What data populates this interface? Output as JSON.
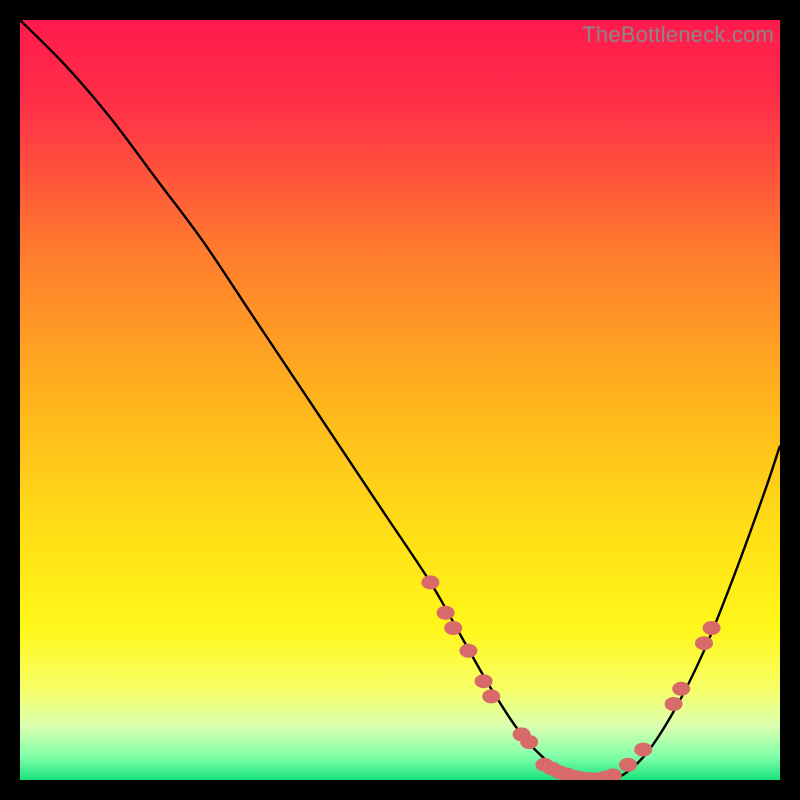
{
  "watermark": "TheBottleneck.com",
  "chart_data": {
    "type": "line",
    "title": "",
    "xlabel": "",
    "ylabel": "",
    "xlim": [
      0,
      100
    ],
    "ylim": [
      0,
      100
    ],
    "curve": {
      "name": "bottleneck-curve",
      "x": [
        0,
        6,
        12,
        18,
        24,
        30,
        36,
        42,
        48,
        54,
        58,
        62,
        66,
        70,
        74,
        78,
        82,
        86,
        90,
        94,
        98,
        100
      ],
      "y": [
        100,
        94,
        87,
        79,
        71,
        62,
        53,
        44,
        35,
        26,
        19,
        12,
        6,
        2,
        0,
        0,
        3,
        9,
        17,
        27,
        38,
        44
      ]
    },
    "markers": {
      "name": "highlighted-points",
      "color": "#d86a6a",
      "points": [
        {
          "x": 54,
          "y": 26
        },
        {
          "x": 56,
          "y": 22
        },
        {
          "x": 57,
          "y": 20
        },
        {
          "x": 59,
          "y": 17
        },
        {
          "x": 61,
          "y": 13
        },
        {
          "x": 62,
          "y": 11
        },
        {
          "x": 66,
          "y": 6
        },
        {
          "x": 67,
          "y": 5
        },
        {
          "x": 69,
          "y": 2
        },
        {
          "x": 70,
          "y": 1.5
        },
        {
          "x": 71,
          "y": 1
        },
        {
          "x": 72,
          "y": 0.7
        },
        {
          "x": 73,
          "y": 0.4
        },
        {
          "x": 74,
          "y": 0.2
        },
        {
          "x": 75,
          "y": 0.1
        },
        {
          "x": 76,
          "y": 0.1
        },
        {
          "x": 77,
          "y": 0.3
        },
        {
          "x": 78,
          "y": 0.6
        },
        {
          "x": 80,
          "y": 2
        },
        {
          "x": 82,
          "y": 4
        },
        {
          "x": 86,
          "y": 10
        },
        {
          "x": 87,
          "y": 12
        },
        {
          "x": 90,
          "y": 18
        },
        {
          "x": 91,
          "y": 20
        }
      ]
    },
    "background": {
      "type": "vertical-gradient",
      "stops": [
        {
          "offset": 0.0,
          "color": "#ff1a4d"
        },
        {
          "offset": 0.12,
          "color": "#ff3247"
        },
        {
          "offset": 0.3,
          "color": "#ff7a2e"
        },
        {
          "offset": 0.5,
          "color": "#ffb41d"
        },
        {
          "offset": 0.68,
          "color": "#ffe016"
        },
        {
          "offset": 0.8,
          "color": "#fff71a"
        },
        {
          "offset": 0.88,
          "color": "#f7ff66"
        },
        {
          "offset": 0.93,
          "color": "#d9ffb0"
        },
        {
          "offset": 0.97,
          "color": "#7effa8"
        },
        {
          "offset": 1.0,
          "color": "#19e27b"
        }
      ]
    }
  }
}
